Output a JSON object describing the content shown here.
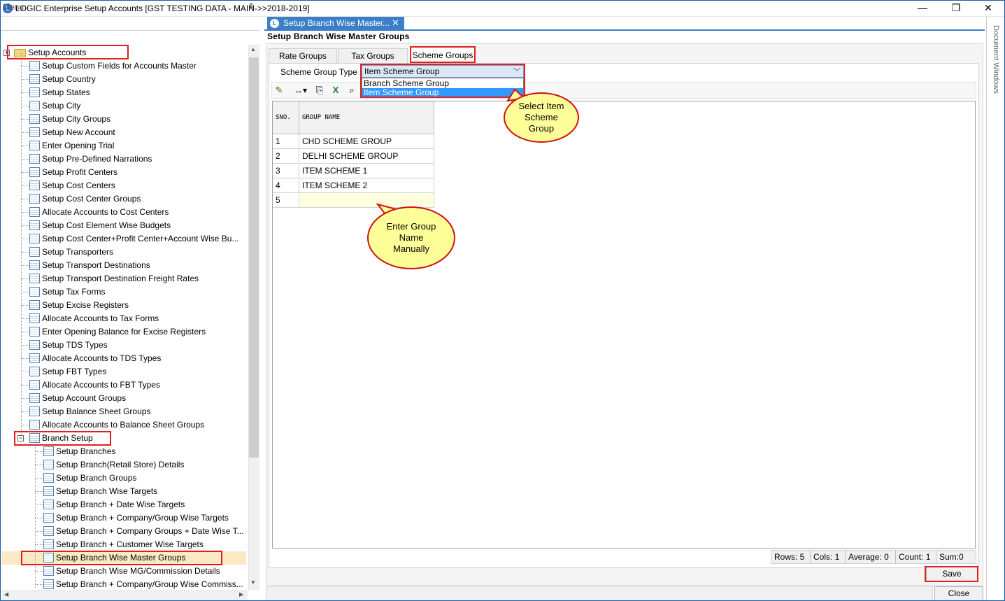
{
  "window": {
    "title": "LOGIC Enterprise Setup Accounts  [GST TESTING DATA - MAIN->>2018-2019]",
    "minimize": "—",
    "restore": "❐",
    "close": "✕"
  },
  "menu": {
    "label": "Menu",
    "pin": "Ⅱ",
    "root": "Setup Accounts",
    "items": [
      "Setup Custom Fields for Accounts Master",
      "Setup Country",
      "Setup States",
      "Setup City",
      "Setup City Groups",
      "Setup New Account",
      "Enter Opening Trial",
      "Setup Pre-Defined Narrations",
      "Setup Profit Centers",
      "Setup Cost Centers",
      "Setup Cost Center Groups",
      "Allocate Accounts to Cost Centers",
      "Setup Cost Element Wise Budgets",
      "Setup Cost Center+Profit Center+Account Wise Bu...",
      "Setup Transporters",
      "Setup Transport Destinations",
      "Setup Transport Destination Freight Rates",
      "Setup Tax Forms",
      "Setup Excise Registers",
      "Allocate Accounts to Tax Forms",
      "Enter Opening Balance for Excise Registers",
      "Setup TDS Types",
      "Allocate Accounts to TDS Types",
      "Setup FBT Types",
      "Allocate Accounts to FBT Types",
      "Setup Account Groups",
      "Setup Balance Sheet Groups",
      "Allocate Accounts to Balance Sheet Groups"
    ],
    "branch_folder": "Branch Setup",
    "branch_items": [
      "Setup Branches",
      "Setup Branch(Retail Store) Details",
      "Setup Branch Groups",
      "Setup Branch Wise Targets",
      "Setup Branch + Date Wise Targets",
      "Setup Branch + Company/Group Wise Targets",
      "Setup Branch + Company Groups + Date Wise T...",
      "Setup Branch + Customer Wise Targets",
      "Setup Branch Wise Master Groups",
      "Setup Branch Wise MG/Commission Details",
      "Setup Branch + Company/Group Wise Commiss..."
    ]
  },
  "doc": {
    "tab_label": "Setup Branch Wise Master...",
    "tab_close": "✕",
    "title": "Setup Branch Wise Master Groups",
    "document_windows": "Document Windows"
  },
  "subtabs": [
    "Rate Groups",
    "Tax Groups",
    "Scheme Groups"
  ],
  "scheme_group_type": {
    "label": "Scheme Group Type",
    "selected": "Item Scheme Group",
    "options": [
      "Branch Scheme Group",
      "Item Scheme Group"
    ]
  },
  "grid": {
    "columns": [
      "SNO.",
      "GROUP NAME"
    ],
    "rows": [
      [
        "1",
        "CHD SCHEME GROUP"
      ],
      [
        "2",
        "DELHI SCHEME GROUP"
      ],
      [
        "3",
        "ITEM SCHEME 1"
      ],
      [
        "4",
        "ITEM SCHEME 2"
      ],
      [
        "5",
        ""
      ]
    ]
  },
  "status": {
    "rows": "Rows: 5",
    "cols": "Cols: 1",
    "average": "Average: 0",
    "count": "Count: 1",
    "sum": "Sum:0"
  },
  "buttons": {
    "save": "Save",
    "close": "Close"
  },
  "callouts": {
    "select": "Select Item Scheme Group",
    "enter": "Enter Group Name Manually"
  },
  "colors": {
    "accent": "#3c7fc9",
    "highlight": "#e02020",
    "callout": "#ffff99"
  }
}
